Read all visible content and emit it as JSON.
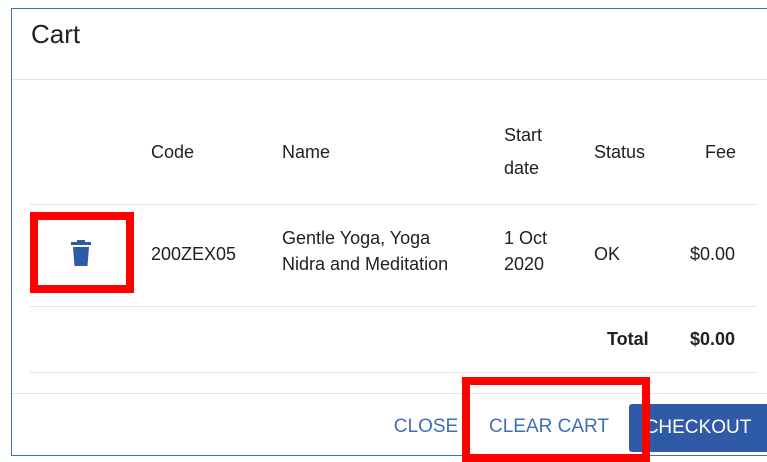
{
  "dialog": {
    "title": "Cart"
  },
  "table": {
    "headers": {
      "code": "Code",
      "name": "Name",
      "start_date_line1": "Start",
      "start_date_line2": "date",
      "status": "Status",
      "fee": "Fee"
    },
    "rows": [
      {
        "code": "200ZEX05",
        "name_line1": "Gentle Yoga, Yoga",
        "name_line2": "Nidra and Meditation",
        "start_line1": "1 Oct",
        "start_line2": "2020",
        "status": "OK",
        "fee": "$0.00"
      }
    ],
    "total_label": "Total",
    "total_value": "$0.00"
  },
  "actions": {
    "close": "CLOSE",
    "clear_cart": "CLEAR CART",
    "checkout": "CHECKOUT"
  },
  "icons": {
    "delete": "trash-icon"
  },
  "colors": {
    "accent": "#3f6fb8",
    "checkout_bg": "#2f5aa8",
    "highlight": "#ff0000"
  }
}
